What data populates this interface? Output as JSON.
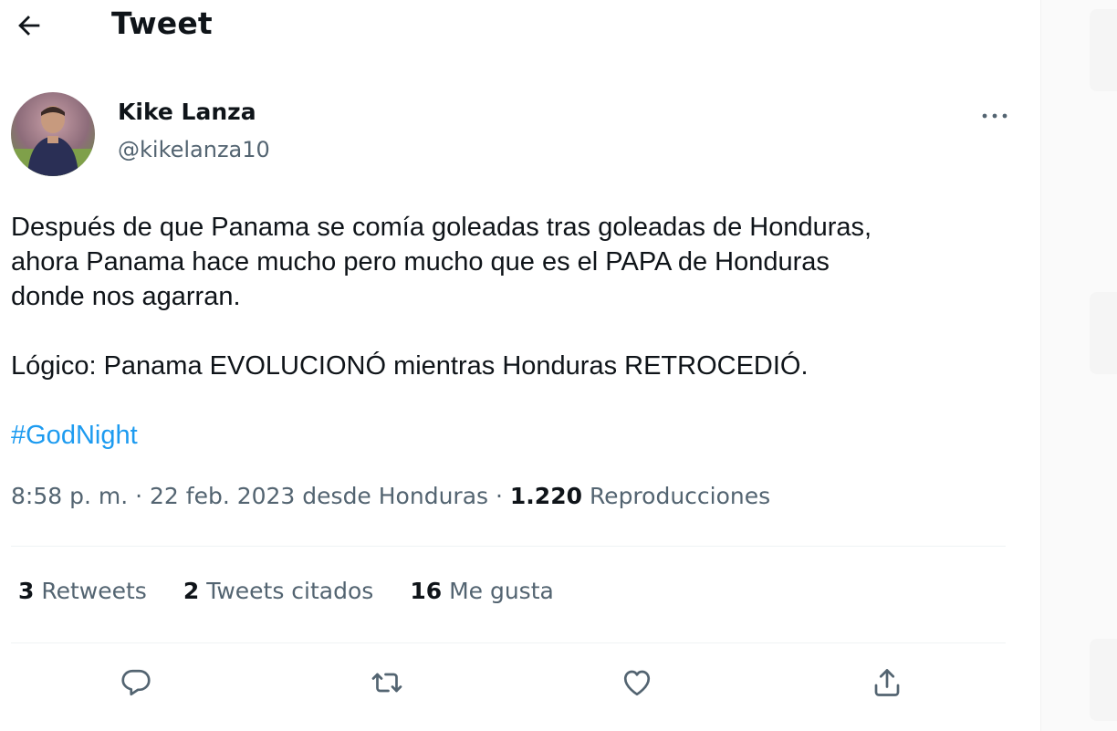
{
  "header": {
    "title": "Tweet"
  },
  "author": {
    "name": "Kike Lanza",
    "handle": "@kikelanza10"
  },
  "tweet": {
    "line1": "Después de que Panama se comía goleadas tras goleadas de Honduras,",
    "line2": "ahora Panama hace mucho pero mucho que es el PAPA de Honduras",
    "line3": "donde nos agarran.",
    "line4": "Lógico: Panama EVOLUCIONÓ mientras Honduras RETROCEDIÓ.",
    "hashtag": "#GodNight"
  },
  "meta": {
    "time": "8:58 p. m.",
    "date_place": "22 feb. 2023 desde Honduras",
    "separator": "·",
    "views_count": "1.220",
    "views_label": "Reproducciones"
  },
  "stats": {
    "retweets_count": "3",
    "retweets_label": "Retweets",
    "quotes_count": "2",
    "quotes_label": "Tweets citados",
    "likes_count": "16",
    "likes_label": "Me gusta"
  },
  "icons": {
    "back": "arrow-left-icon",
    "more": "more-dots-icon",
    "reply": "reply-icon",
    "retweet": "retweet-icon",
    "like": "heart-icon",
    "share": "share-icon"
  },
  "colors": {
    "text": "#0f1419",
    "secondary": "#536471",
    "link": "#1d9bf0",
    "divider": "#eff3f4"
  }
}
